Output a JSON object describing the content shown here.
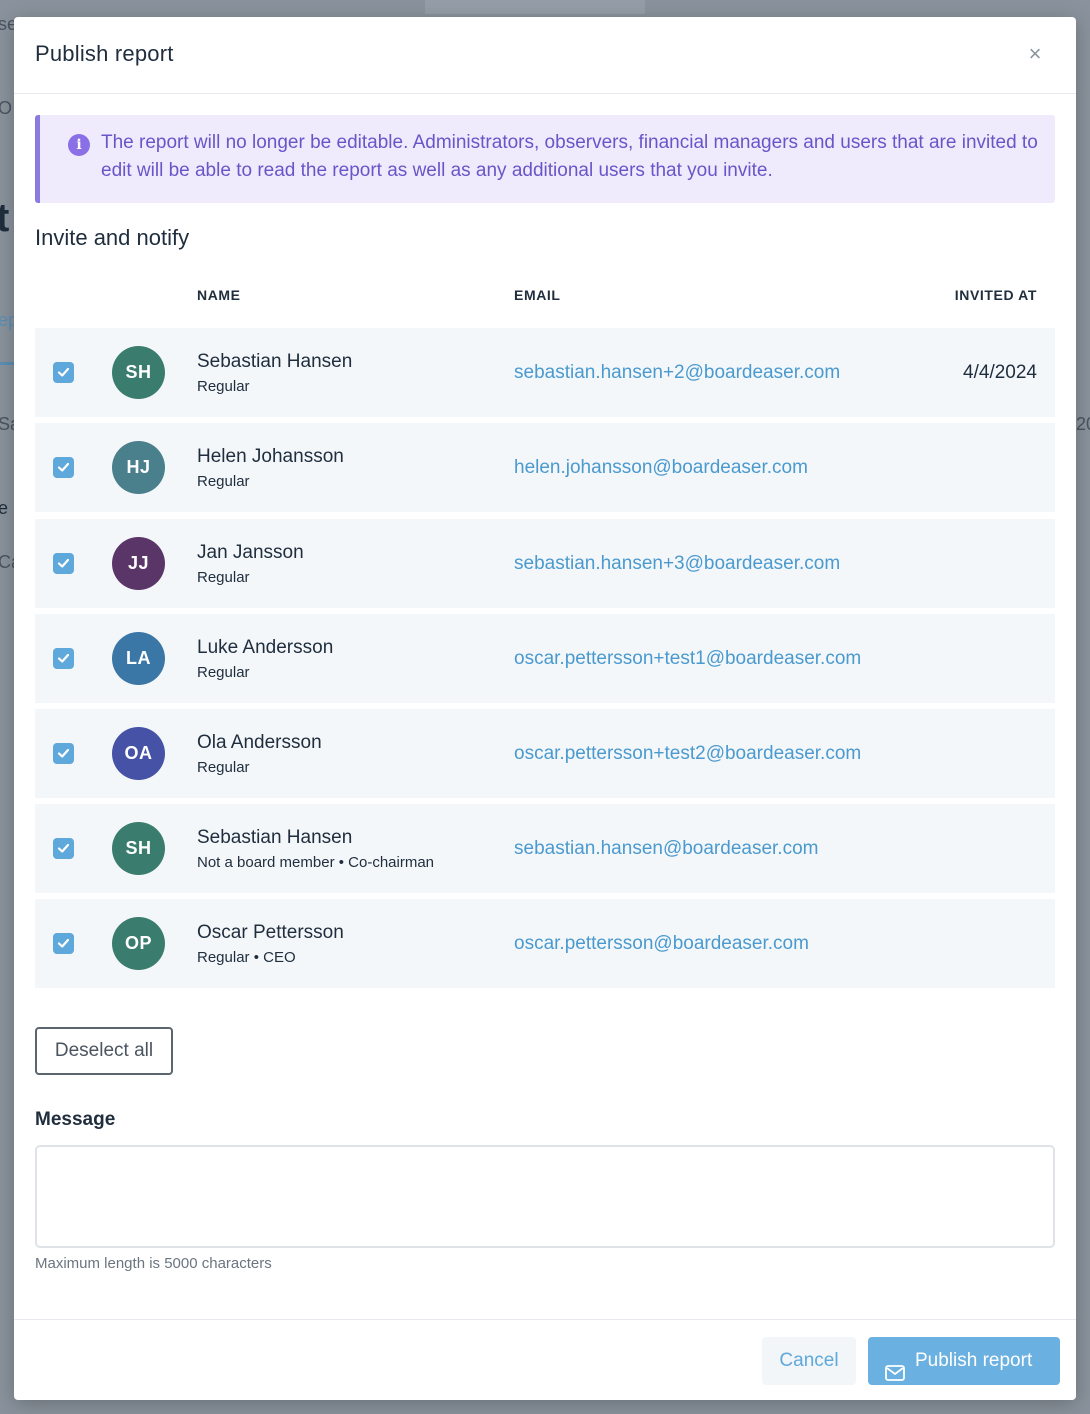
{
  "modal": {
    "title": "Publish report",
    "close_label": "×"
  },
  "alert": {
    "icon": "info-icon",
    "text": "The report will no longer be editable. Administrators, observers, financial managers and users that are invited to edit will be able to read the report as well as any additional users that you invite."
  },
  "invite": {
    "title": "Invite and notify",
    "headers": {
      "name": "NAME",
      "email": "EMAIL",
      "invited_at": "INVITED AT"
    },
    "rows": [
      {
        "checked": true,
        "initials": "SH",
        "avatar_color": "#3a7d6e",
        "name": "Sebastian Hansen",
        "role": "Regular",
        "email": "sebastian.hansen+2@boardeaser.com",
        "invited_at": "4/4/2024"
      },
      {
        "checked": true,
        "initials": "HJ",
        "avatar_color": "#4a7f8c",
        "name": "Helen Johansson",
        "role": "Regular",
        "email": "helen.johansson@boardeaser.com",
        "invited_at": ""
      },
      {
        "checked": true,
        "initials": "JJ",
        "avatar_color": "#5a3668",
        "name": "Jan Jansson",
        "role": "Regular",
        "email": "sebastian.hansen+3@boardeaser.com",
        "invited_at": ""
      },
      {
        "checked": true,
        "initials": "LA",
        "avatar_color": "#3a76a6",
        "name": "Luke Andersson",
        "role": "Regular",
        "email": "oscar.pettersson+test1@boardeaser.com",
        "invited_at": ""
      },
      {
        "checked": true,
        "initials": "OA",
        "avatar_color": "#4552a6",
        "name": "Ola Andersson",
        "role": "Regular",
        "email": "oscar.pettersson+test2@boardeaser.com",
        "invited_at": ""
      },
      {
        "checked": true,
        "initials": "SH",
        "avatar_color": "#3a7d6e",
        "name": "Sebastian Hansen",
        "role": "Not a board member • Co-chairman",
        "email": "sebastian.hansen@boardeaser.com",
        "invited_at": ""
      },
      {
        "checked": true,
        "initials": "OP",
        "avatar_color": "#3a7d6e",
        "name": "Oscar Pettersson",
        "role": "Regular • CEO",
        "email": "oscar.pettersson@boardeaser.com",
        "invited_at": ""
      }
    ],
    "deselect_label": "Deselect all"
  },
  "message": {
    "label": "Message",
    "value": "",
    "hint": "Maximum length is 5000 characters"
  },
  "footer": {
    "cancel_label": "Cancel",
    "publish_label": "Publish report",
    "publish_icon": "envelope-icon"
  },
  "colors": {
    "accent": "#6ab0e0",
    "link": "#4a9acf",
    "alert_bg": "#efebfc",
    "alert_text": "#6a55c8"
  }
}
